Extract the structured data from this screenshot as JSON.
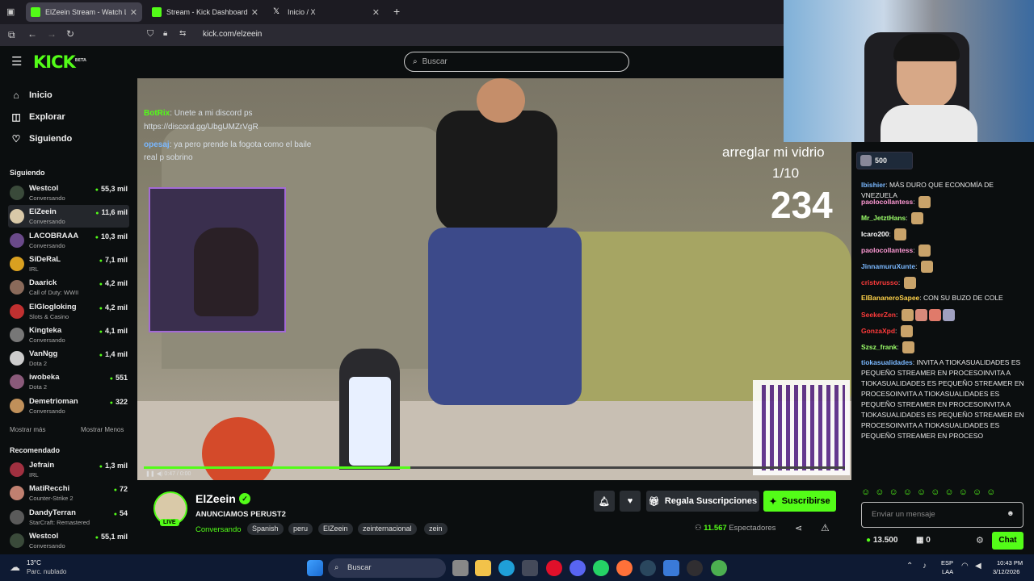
{
  "browser": {
    "tabs": [
      {
        "title": "ElZeein Stream - Watch Live",
        "active": true,
        "icon": "kick-icon"
      },
      {
        "title": "Stream - Kick Dashboard",
        "active": false,
        "icon": "kick-icon"
      },
      {
        "title": "Inicio / X",
        "active": false,
        "icon": "x-icon"
      }
    ],
    "url": "kick.com/elzeein"
  },
  "header": {
    "logo": "KICK",
    "logo_badge": "BETA",
    "search_placeholder": "Buscar"
  },
  "sidebar": {
    "nav": [
      {
        "label": "Inicio",
        "icon": "home-icon"
      },
      {
        "label": "Explorar",
        "icon": "compass-icon"
      },
      {
        "label": "Siguiendo",
        "icon": "heart-icon"
      }
    ],
    "following_title": "Siguiendo",
    "following": [
      {
        "name": "Westcol",
        "category": "Conversando",
        "viewers": "55,3 mil",
        "color": "#3a4a3a"
      },
      {
        "name": "ElZeein",
        "category": "Conversando",
        "viewers": "11,6 mil",
        "color": "#d9c9a8"
      },
      {
        "name": "LACOBRAAA",
        "category": "Conversando",
        "viewers": "10,3 mil",
        "color": "#6a4a8a"
      },
      {
        "name": "SiDeRaL",
        "category": "IRL",
        "viewers": "7,1 mil",
        "color": "#d9a020"
      },
      {
        "name": "Daarick",
        "category": "Call of Duty: WWII",
        "viewers": "4,2 mil",
        "color": "#8a6a5a"
      },
      {
        "name": "ElGlogloking",
        "category": "Slots & Casino",
        "viewers": "4,2 mil",
        "color": "#c03030"
      },
      {
        "name": "Kingteka",
        "category": "Conversando",
        "viewers": "4,1 mil",
        "color": "#777777"
      },
      {
        "name": "VanNgg",
        "category": "Dota 2",
        "viewers": "1,4 mil",
        "color": "#cccccc"
      },
      {
        "name": "iwobeka",
        "category": "Dota 2",
        "viewers": "551",
        "color": "#8a5a7a"
      },
      {
        "name": "Demetrioman",
        "category": "Conversando",
        "viewers": "322",
        "color": "#c0905a"
      }
    ],
    "show_more": "Mostrar más",
    "show_less": "Mostrar Menos",
    "recommended_title": "Recomendado",
    "recommended": [
      {
        "name": "Jefrain",
        "category": "IRL",
        "viewers": "1,3 mil",
        "color": "#a03040"
      },
      {
        "name": "MatiRecchi",
        "category": "Counter-Strike 2",
        "viewers": "72",
        "color": "#c08070"
      },
      {
        "name": "DandyTerran",
        "category": "StarCraft: Remastered",
        "viewers": "54",
        "color": "#5a5a5a"
      },
      {
        "name": "Westcol",
        "category": "Conversando",
        "viewers": "55,1 mil",
        "color": "#3a4a3a"
      }
    ]
  },
  "video": {
    "overlay_chat": [
      {
        "user": "BotRix",
        "text": "Unete a mi discord ps"
      },
      {
        "user": "",
        "text": "https://discord.gg/UbgUMZrVgR"
      },
      {
        "user": "opesaj",
        "text": "ya pero prende la fogota como el baile"
      },
      {
        "user": "",
        "text": "real p sobrino"
      }
    ],
    "goal_text": "arreglar mi vidrio",
    "goal_progress": "1/10",
    "counter": "234",
    "progress": 0.38,
    "time_label": "0:47 / 0:00"
  },
  "stream": {
    "name": "ElZeein",
    "live_label": "LIVE",
    "title": "ANUNCIAMOS PERUST2",
    "category": "Conversando",
    "tags": [
      "Spanish",
      "peru",
      "ElZeein",
      "zeinternacional",
      "zein"
    ],
    "gift_label": "Regala Suscripciones",
    "subscribe_label": "Suscribirse",
    "viewers": "11.567",
    "viewers_label": "Espectadores"
  },
  "chat": {
    "pinned_amount": "500",
    "messages": [
      {
        "user": "lbishier",
        "color": "#7ab8ff",
        "text": "MÁS DURO QUE ECONOMÍA DE VNEZUELA",
        "emotes": 0
      },
      {
        "user": "paolocollantess",
        "color": "#ff9ad5",
        "text": "",
        "emotes": 1
      },
      {
        "user": "Mr_JetztHans",
        "color": "#9cff6a",
        "text": "",
        "emotes": 1
      },
      {
        "user": "Icaro200",
        "color": "#ffffff",
        "text": "",
        "emotes": 1
      },
      {
        "user": "paolocollantess",
        "color": "#ff9ad5",
        "text": "",
        "emotes": 1
      },
      {
        "user": "JinnamuruXunte",
        "color": "#7ab8ff",
        "text": "",
        "emotes": 1
      },
      {
        "user": "cristvrusso",
        "color": "#ff3b3b",
        "text": "",
        "emotes": 1
      },
      {
        "user": "ElBananeroSapee",
        "color": "#ffd24a",
        "text": "CON SU BUZO DE COLE",
        "emotes": 0
      },
      {
        "user": "SeekerZen",
        "color": "#ff3b3b",
        "text": "",
        "emotes": 4
      },
      {
        "user": "GonzaXpd",
        "color": "#ff3b3b",
        "text": "",
        "emotes": 1
      },
      {
        "user": "Szsz_frank",
        "color": "#9cff6a",
        "text": "",
        "emotes": 1
      },
      {
        "user": "tiokasualidades",
        "color": "#7ab8ff",
        "text": "INVITA A TIOKASUALIDADES ES PEQUEÑO STREAMER EN PROCESOINVITA A TIOKASUALIDADES ES PEQUEÑO STREAMER EN PROCESOINVITA A TIOKASUALIDADES ES PEQUEÑO STREAMER EN PROCESOINVITA A TIOKASUALIDADES ES PEQUEÑO STREAMER EN PROCESOINVITA A TIOKASUALIDADES ES PEQUEÑO STREAMER EN PROCESO",
        "emotes": 0
      }
    ],
    "input_placeholder": "Enviar un mensaje",
    "points": "13.500",
    "gifts": "0",
    "send_label": "Chat"
  },
  "taskbar": {
    "weather_temp": "13°C",
    "weather_desc": "Parc. nublado",
    "search_label": "Buscar",
    "lang": "ESP",
    "lang_sub": "LAA",
    "time": "10:43 PM",
    "date": "3/12/2026"
  },
  "colors": {
    "accent": "#53fc18",
    "background": "#0b0e0f"
  }
}
